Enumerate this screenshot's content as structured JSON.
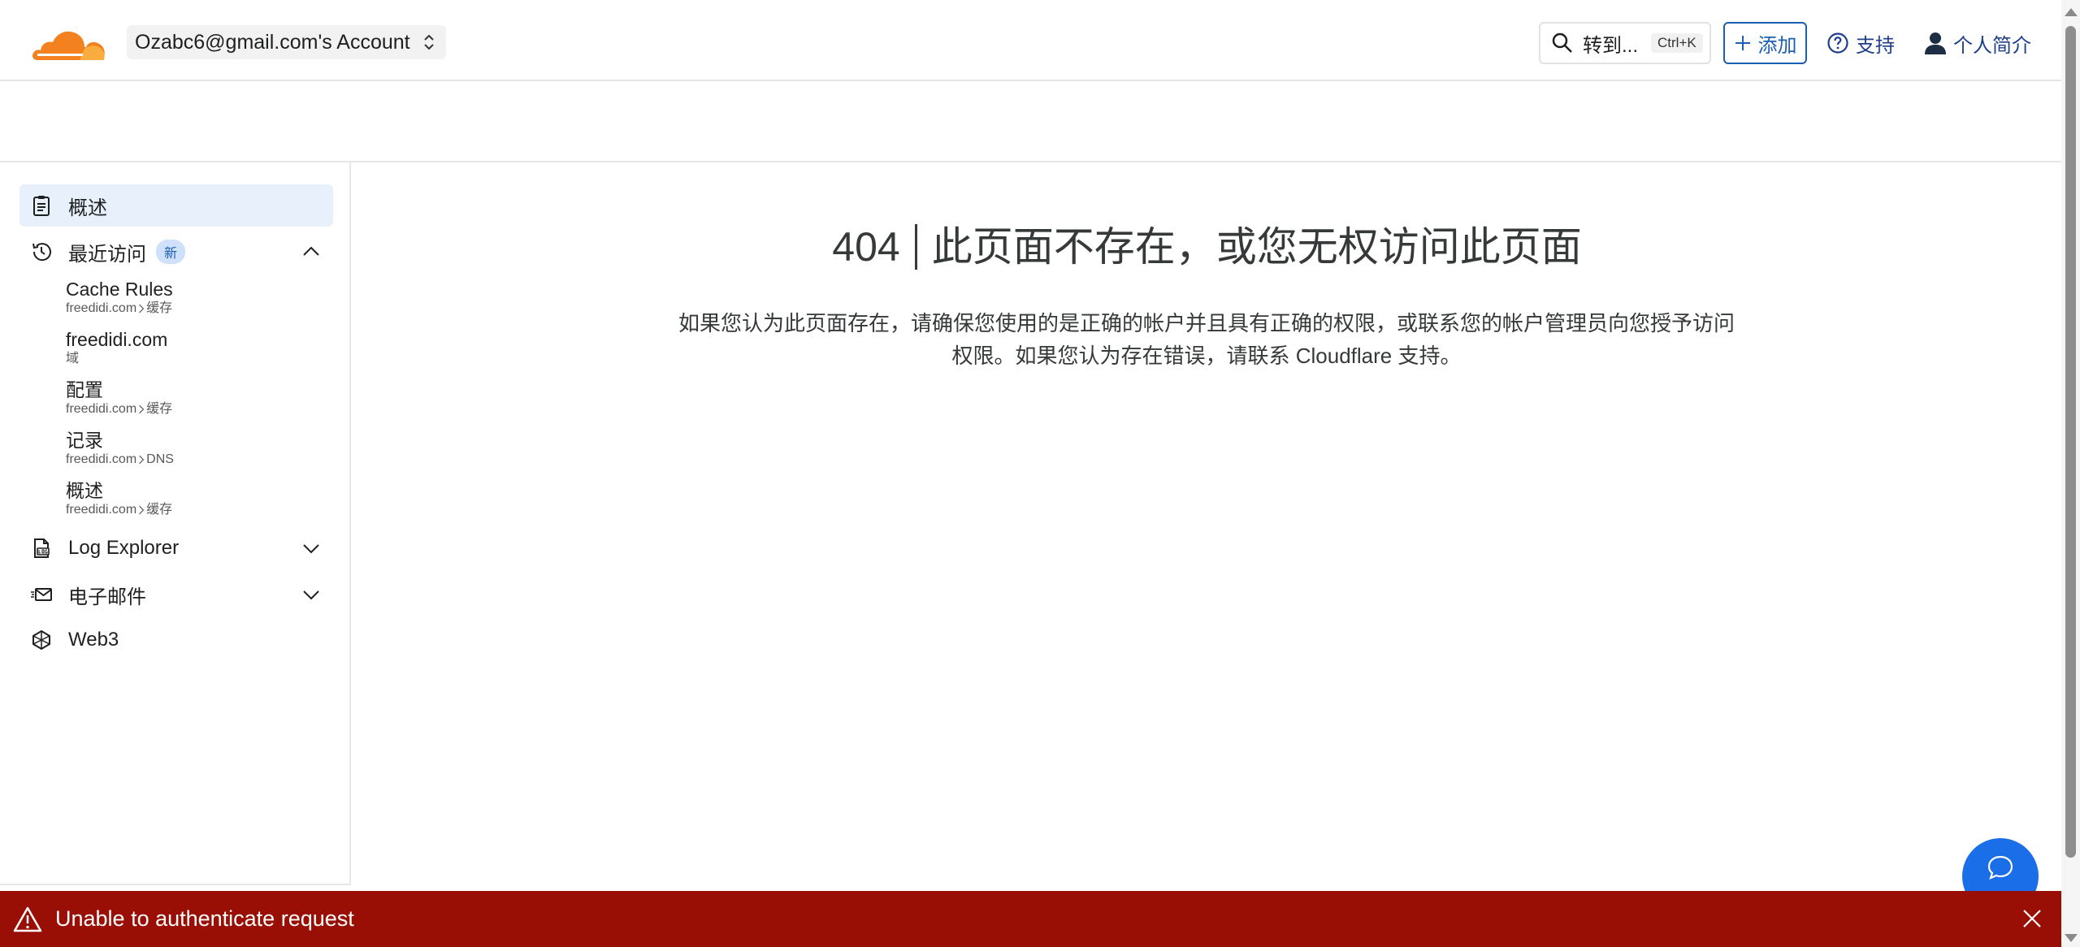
{
  "header": {
    "account_label": "Ozabc6@gmail.com's Account",
    "search_label": "转到...",
    "search_shortcut": "Ctrl+K",
    "add_label": "添加",
    "support_label": "支持",
    "profile_label": "个人简介"
  },
  "sidebar": {
    "overview_label": "概述",
    "recent_label": "最近访问",
    "recent_badge": "新",
    "recent_items": [
      {
        "title": "Cache Rules",
        "domain": "freedidi.com",
        "section": "缓存"
      },
      {
        "title": "freedidi.com",
        "domain": "域",
        "section": ""
      },
      {
        "title": "配置",
        "domain": "freedidi.com",
        "section": "缓存"
      },
      {
        "title": "记录",
        "domain": "freedidi.com",
        "section": "DNS"
      },
      {
        "title": "概述",
        "domain": "freedidi.com",
        "section": "缓存"
      }
    ],
    "log_explorer_label": "Log Explorer",
    "email_label": "电子邮件",
    "web3_label": "Web3"
  },
  "main": {
    "error_code": "404",
    "error_title": "此页面不存在，或您无权访问此页面",
    "desc_line1": "如果您认为此页面存在，请确保您使用的是正确的帐户并且具有正确的权限，或联系您的帐户管理员向您授予访问",
    "desc_line2_prefix": "权限。如果您认为存在错误，请联系 ",
    "desc_link": "Cloudflare 支持",
    "desc_line2_suffix": "。"
  },
  "banner": {
    "message": "Unable to authenticate request"
  },
  "colors": {
    "accent": "#1a5fb4",
    "error_banner": "#9a0f05",
    "chat_fab": "#1a6ee8",
    "active_nav_bg": "#e8f0fb"
  }
}
